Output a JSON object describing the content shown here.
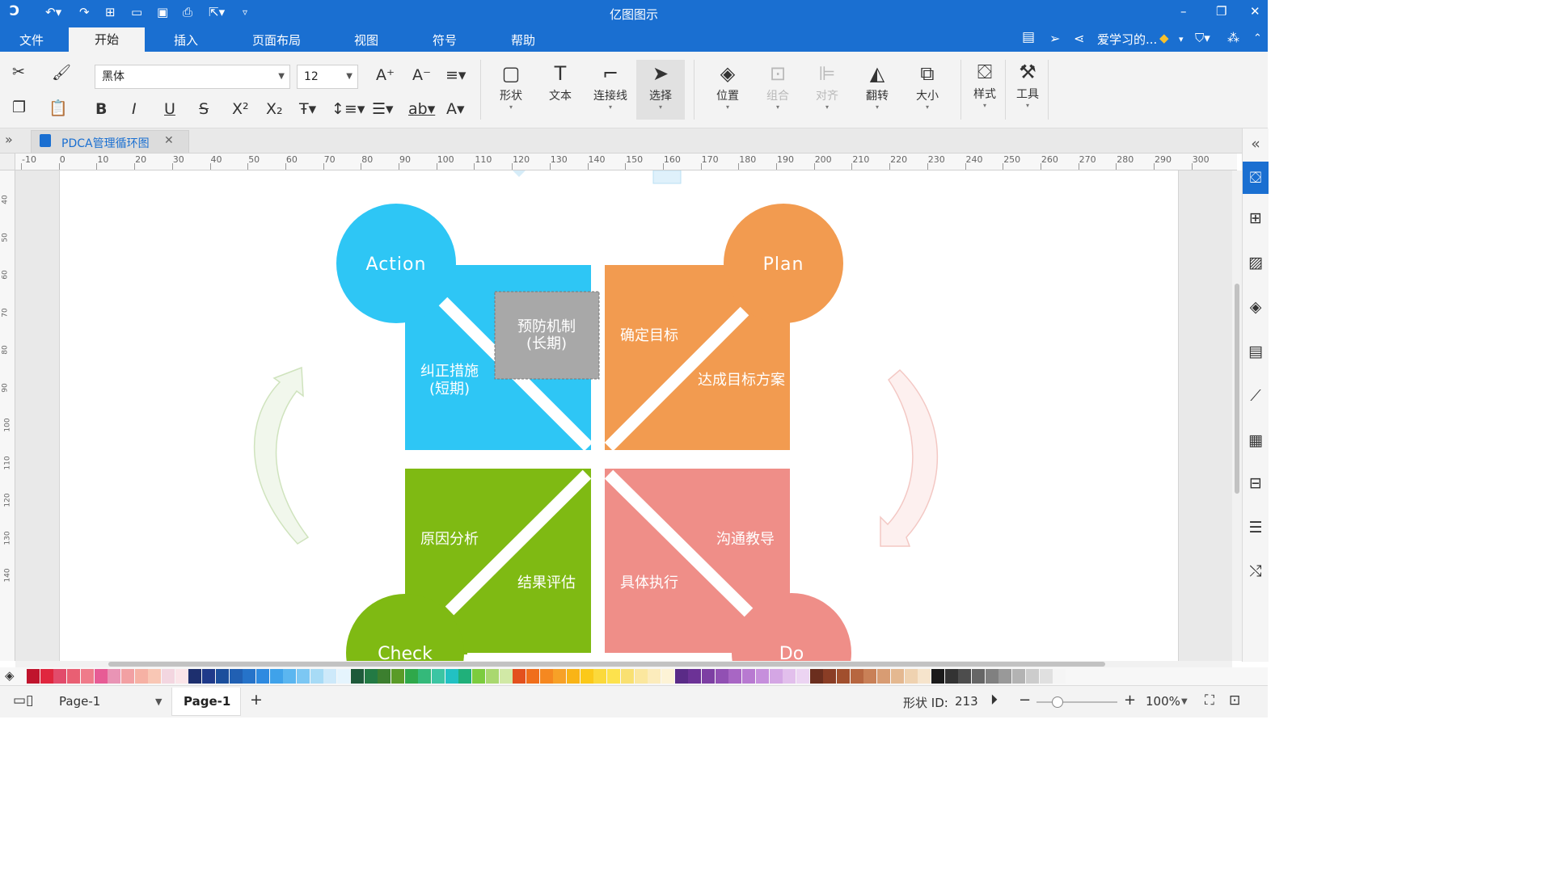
{
  "window": {
    "title": "亿图图示",
    "minimize_icon": "minimize-icon",
    "restore_icon": "restore-icon",
    "close_icon": "close-icon"
  },
  "quick_access": {
    "logo_icon": "app-logo-icon",
    "undo_icon": "undo-icon",
    "redo_icon": "redo-icon",
    "new_icon": "new-file-icon",
    "open_icon": "open-folder-icon",
    "save_icon": "save-icon",
    "print_icon": "print-icon",
    "export_icon": "export-icon",
    "customize_icon": "customize-icon"
  },
  "menu": {
    "items": [
      "文件",
      "开始",
      "插入",
      "页面布局",
      "视图",
      "符号",
      "帮助"
    ],
    "active": "开始",
    "user_name": "爱学习的...",
    "right_icons": [
      "comment-icon",
      "send-icon",
      "share-icon",
      "diamond-icon",
      "shirt-icon",
      "apps-icon",
      "collapse-icon"
    ]
  },
  "ribbon": {
    "font_name": "黑体",
    "font_size": "12",
    "big_buttons": [
      {
        "label": "形状",
        "icon": "rectangle-icon"
      },
      {
        "label": "文本",
        "icon": "text-icon"
      },
      {
        "label": "连接线",
        "icon": "connector-icon"
      },
      {
        "label": "选择",
        "icon": "pointer-icon"
      },
      {
        "label": "位置",
        "icon": "layers-icon"
      },
      {
        "label": "组合",
        "icon": "group-icon"
      },
      {
        "label": "对齐",
        "icon": "align-icon"
      },
      {
        "label": "翻转",
        "icon": "flip-icon"
      },
      {
        "label": "大小",
        "icon": "size-icon"
      },
      {
        "label": "样式",
        "icon": "paint-bucket-icon"
      },
      {
        "label": "工具",
        "icon": "tools-icon"
      }
    ],
    "disabled": [
      "组合",
      "对齐"
    ],
    "selected": "选择"
  },
  "tabs": {
    "doc_name": "PDCA管理循环图",
    "expand_icon": "expand-panel-icon",
    "close_icon": "close-icon"
  },
  "rulers": {
    "h_ticks": [
      "-10",
      "0",
      "10",
      "20",
      "30",
      "40",
      "50",
      "60",
      "70",
      "80",
      "90",
      "100",
      "110",
      "120",
      "130",
      "140",
      "150",
      "160",
      "170",
      "180",
      "190",
      "200",
      "210",
      "220",
      "230",
      "240",
      "250",
      "260",
      "270",
      "280",
      "290",
      "300"
    ],
    "v_ticks": [
      "40",
      "50",
      "60",
      "70",
      "80",
      "90",
      "100",
      "110",
      "120",
      "130",
      "140"
    ]
  },
  "diagram": {
    "action": "Action",
    "plan": "Plan",
    "check": "Check",
    "do": "Do",
    "prevent_line1": "预防机制",
    "prevent_line2": "(长期)",
    "correct_line1": "纠正措施",
    "correct_line2": "(短期)",
    "target": "确定目标",
    "plan_scheme": "达成目标方案",
    "cause": "原因分析",
    "result": "结果评估",
    "execute": "具体执行",
    "communicate": "沟通教导",
    "colors": {
      "action": "#2ec6f5",
      "plan": "#f29b50",
      "check": "#7fba13",
      "do": "#ef8e88",
      "selected": "#a8a8a8"
    }
  },
  "status": {
    "page_select": "Page-1",
    "page_tab": "Page-1",
    "shape_id_label": "形状 ID:",
    "shape_id": "213",
    "zoom": "100%"
  }
}
